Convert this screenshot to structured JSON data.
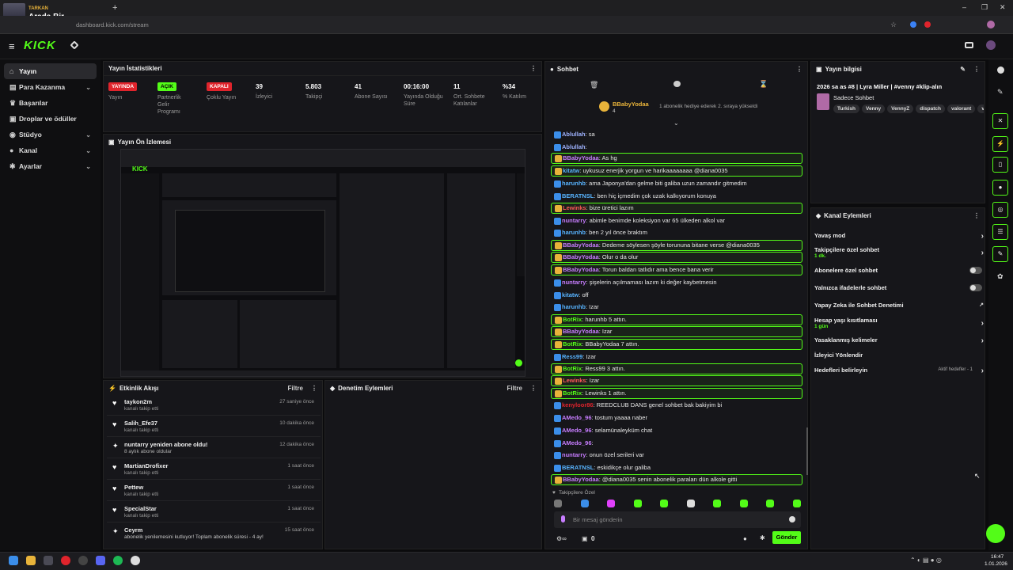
{
  "browser": {
    "tab_subtitle": "TARKAN",
    "tab_title": "Arada Bir",
    "new_tab": "+",
    "url": "dashboard.kick.com/stream",
    "win_min": "–",
    "win_max": "❐",
    "win_close": "✕"
  },
  "header": {
    "logo": "KICK",
    "menu_icon": "≡",
    "pin_icon": "📌"
  },
  "sidebar": {
    "items": [
      {
        "label": "Yayın",
        "icon": "home-icon",
        "glyph": "⌂"
      },
      {
        "label": "Para Kazanma",
        "icon": "wallet-icon",
        "glyph": "▤",
        "chev": "⌄"
      },
      {
        "label": "Başarılar",
        "icon": "trophy-icon",
        "glyph": "♛"
      },
      {
        "label": "Droplar ve ödüller",
        "icon": "gift-icon",
        "glyph": "▣"
      },
      {
        "label": "Stüdyo",
        "icon": "studio-icon",
        "glyph": "◉",
        "chev": "⌄"
      },
      {
        "label": "Kanal",
        "icon": "user-icon",
        "glyph": "●",
        "chev": "⌄"
      },
      {
        "label": "Ayarlar",
        "icon": "gear-icon",
        "glyph": "✱",
        "chev": "⌄"
      }
    ]
  },
  "stats": {
    "title": "Yayın İstatistikleri",
    "items": [
      {
        "badge": "YAYINDA",
        "badge_color": "#e0242c",
        "label": "Yayın"
      },
      {
        "badge": "AÇIK",
        "badge_color": "#53fc18",
        "label": "Partnerlik Gelir Programı"
      },
      {
        "badge": "KAPALI",
        "badge_color": "#e0242c",
        "label": "Çoklu Yayın"
      },
      {
        "value": "39",
        "label": "İzleyici"
      },
      {
        "value": "5.803",
        "label": "Takipçi"
      },
      {
        "value": "41",
        "label": "Abone Sayısı"
      },
      {
        "value": "00:16:00",
        "label": "Yayında Olduğu Süre"
      },
      {
        "value": "11",
        "label": "Ort. Sohbete Katılanlar"
      },
      {
        "value": "%34",
        "label": "% Katılım"
      }
    ]
  },
  "preview": {
    "title": "Yayın Ön İzlemesi"
  },
  "activity": {
    "title": "Etkinlik Akışı",
    "filter": "Filtre",
    "events": [
      {
        "name": "taykon2m",
        "sub": "kanalı takip etti",
        "time": "27 saniye önce",
        "icon": "heart-icon",
        "glyph": "♥"
      },
      {
        "name": "Salih_Efe37",
        "sub": "kanalı takip etti",
        "time": "10 dakika önce",
        "icon": "heart-icon",
        "glyph": "♥"
      },
      {
        "name": "nuntarry yeniden abone oldu!",
        "sub": "8 aylık abone oldular",
        "time": "12 dakika önce",
        "icon": "star-icon",
        "glyph": "✦"
      },
      {
        "name": "MartianDrofixer",
        "sub": "kanalı takip etti",
        "time": "1 saat önce",
        "icon": "heart-icon",
        "glyph": "♥"
      },
      {
        "name": "Pettew",
        "sub": "kanalı takip etti",
        "time": "1 saat önce",
        "icon": "heart-icon",
        "glyph": "♥"
      },
      {
        "name": "SpecialStar",
        "sub": "kanalı takip etti",
        "time": "1 saat önce",
        "icon": "heart-icon",
        "glyph": "♥"
      },
      {
        "name": "Ceyrm",
        "sub": "abonelik yenilemesini kutluyor! Toplam abonelik süresi - 4 ay!",
        "time": "15 saat önce",
        "icon": "star-icon",
        "glyph": "✦"
      }
    ]
  },
  "moderation": {
    "title": "Denetim Eylemleri",
    "filter": "Filtre"
  },
  "chat": {
    "title": "Sohbet",
    "gift_user": "BBabyYodaa",
    "gift_count": "4",
    "gift_text": "1 abonelik hediye ederek 2. sıraya yükseldi",
    "messages": [
      {
        "user": "Ablullah",
        "text": "sa",
        "color": "#9fb3ff",
        "hl": false
      },
      {
        "user": "Ablullah",
        "text": "",
        "color": "#9fb3ff",
        "hl": false
      },
      {
        "user": "BBabyYodaa",
        "text": "As hg",
        "color": "#c77dff",
        "hl": true
      },
      {
        "user": "kitatw",
        "text": "uykusuz enerjik yorgun ve harikaaaaaaaa @diana0035",
        "color": "#58b4ff",
        "hl": true
      },
      {
        "user": "harunhb",
        "text": "ama Japonya'dan gelme biti galiba uzun zamandır gitmedim",
        "color": "#58b4ff",
        "hl": false
      },
      {
        "user": "BERATNSL",
        "text": "ben hiç içmedim çok uzak kalkıyorum konuya",
        "color": "#58b4ff",
        "hl": false
      },
      {
        "user": "Lewinks",
        "text": "bize üretici lazım",
        "color": "#ff5a5a",
        "hl": true
      },
      {
        "user": "nuntarry",
        "text": "abimle benimde koleksiyon var 65 ülkeden alkol var",
        "color": "#c77dff",
        "hl": false
      },
      {
        "user": "harunhb",
        "text": "ben 2 yıl önce braktım",
        "color": "#58b4ff",
        "hl": false
      },
      {
        "user": "BBabyYodaa",
        "text": "Dedeme söylesen şöyle torununa bitane verse @diana0035",
        "color": "#c77dff",
        "hl": true
      },
      {
        "user": "BBabyYodaa",
        "text": "Olur o da olur",
        "color": "#c77dff",
        "hl": true
      },
      {
        "user": "BBabyYodaa",
        "text": "Torun baldan tatlıdır ama bence bana verir",
        "color": "#c77dff",
        "hl": true
      },
      {
        "user": "nuntarry",
        "text": "şişelerin açılmaması lazım ki değer kaybetmesin",
        "color": "#c77dff",
        "hl": false
      },
      {
        "user": "kitatw",
        "text": "off",
        "color": "#58b4ff",
        "hl": false
      },
      {
        "user": "harunhb",
        "text": "Izar",
        "color": "#58b4ff",
        "hl": false
      },
      {
        "user": "BotRix",
        "text": "harunhb 5 attın.",
        "color": "#53fc18",
        "hl": true
      },
      {
        "user": "BBabyYodaa",
        "text": "Izar",
        "color": "#c77dff",
        "hl": true
      },
      {
        "user": "BotRix",
        "text": "BBabyYodaa 7 attın.",
        "color": "#53fc18",
        "hl": true
      },
      {
        "user": "Ress99",
        "text": "Izar",
        "color": "#58b4ff",
        "hl": false
      },
      {
        "user": "BotRix",
        "text": "Ress99 3 attın.",
        "color": "#53fc18",
        "hl": true
      },
      {
        "user": "Lewinks",
        "text": "Izar",
        "color": "#ff5a5a",
        "hl": true
      },
      {
        "user": "BotRix",
        "text": "Lewinks 1 attın.",
        "color": "#53fc18",
        "hl": true
      },
      {
        "user": "kenyloor86",
        "text": "REEDCLUB DANS genel sohbet bak bakiyim bi",
        "color": "#e0242c",
        "hl": false
      },
      {
        "user": "AMedo_96",
        "text": "tostum yaaaa naber",
        "color": "#c77dff",
        "hl": false
      },
      {
        "user": "AMedo_96",
        "text": "selamünaleyküm chat",
        "color": "#c77dff",
        "hl": false
      },
      {
        "user": "AMedo_96",
        "text": "",
        "color": "#c77dff",
        "hl": false
      },
      {
        "user": "nuntarry",
        "text": "onun özel serileri var",
        "color": "#c77dff",
        "hl": false
      },
      {
        "user": "BERATNSL",
        "text": "eskidikçe olur galiba",
        "color": "#58b4ff",
        "hl": false
      },
      {
        "user": "BBabyYodaa",
        "text": "@diana0035 senin abonelik paraları dün alkole gitti",
        "color": "#c77dff",
        "hl": true
      }
    ],
    "followers_only": "Takipçilere Özel",
    "input_placeholder": "Bir mesaj gönderin",
    "send": "Gönder",
    "points": "0"
  },
  "stream_info": {
    "title": "Yayın bilgisi",
    "stream_title": "2026 sa as #8 | Lyra Miller | #venny #klip-alın",
    "category": "Sadece Sohbet",
    "tags": [
      "Turkish",
      "Venny",
      "VennyZ",
      "dispatch",
      "valorant",
      "ven"
    ]
  },
  "channel_actions": {
    "title": "Kanal Eylemleri",
    "items": [
      {
        "label": "Yavaş mod",
        "type": "arrow"
      },
      {
        "label": "Takipçilere özel sohbet",
        "sub": "1 dk.",
        "type": "arrow"
      },
      {
        "label": "Abonelere özel sohbet",
        "type": "toggle"
      },
      {
        "label": "Yalnızca ifadelerle sohbet",
        "type": "toggle"
      },
      {
        "label": "Yapay Zeka ile Sohbet Denetimi",
        "type": "ext"
      },
      {
        "label": "Hesap yaşı kısıtlaması",
        "sub": "1 gün",
        "type": "arrow"
      },
      {
        "label": "Yasaklanmış kelimeler",
        "type": "arrow"
      },
      {
        "label": "İzleyici Yönlendir",
        "type": "none"
      },
      {
        "label": "Hedefleri belirleyin",
        "note": "Aktif hedefler - 1",
        "type": "arrow"
      }
    ]
  },
  "taskbar": {
    "time": "16:47",
    "date": "1.01.2026"
  }
}
